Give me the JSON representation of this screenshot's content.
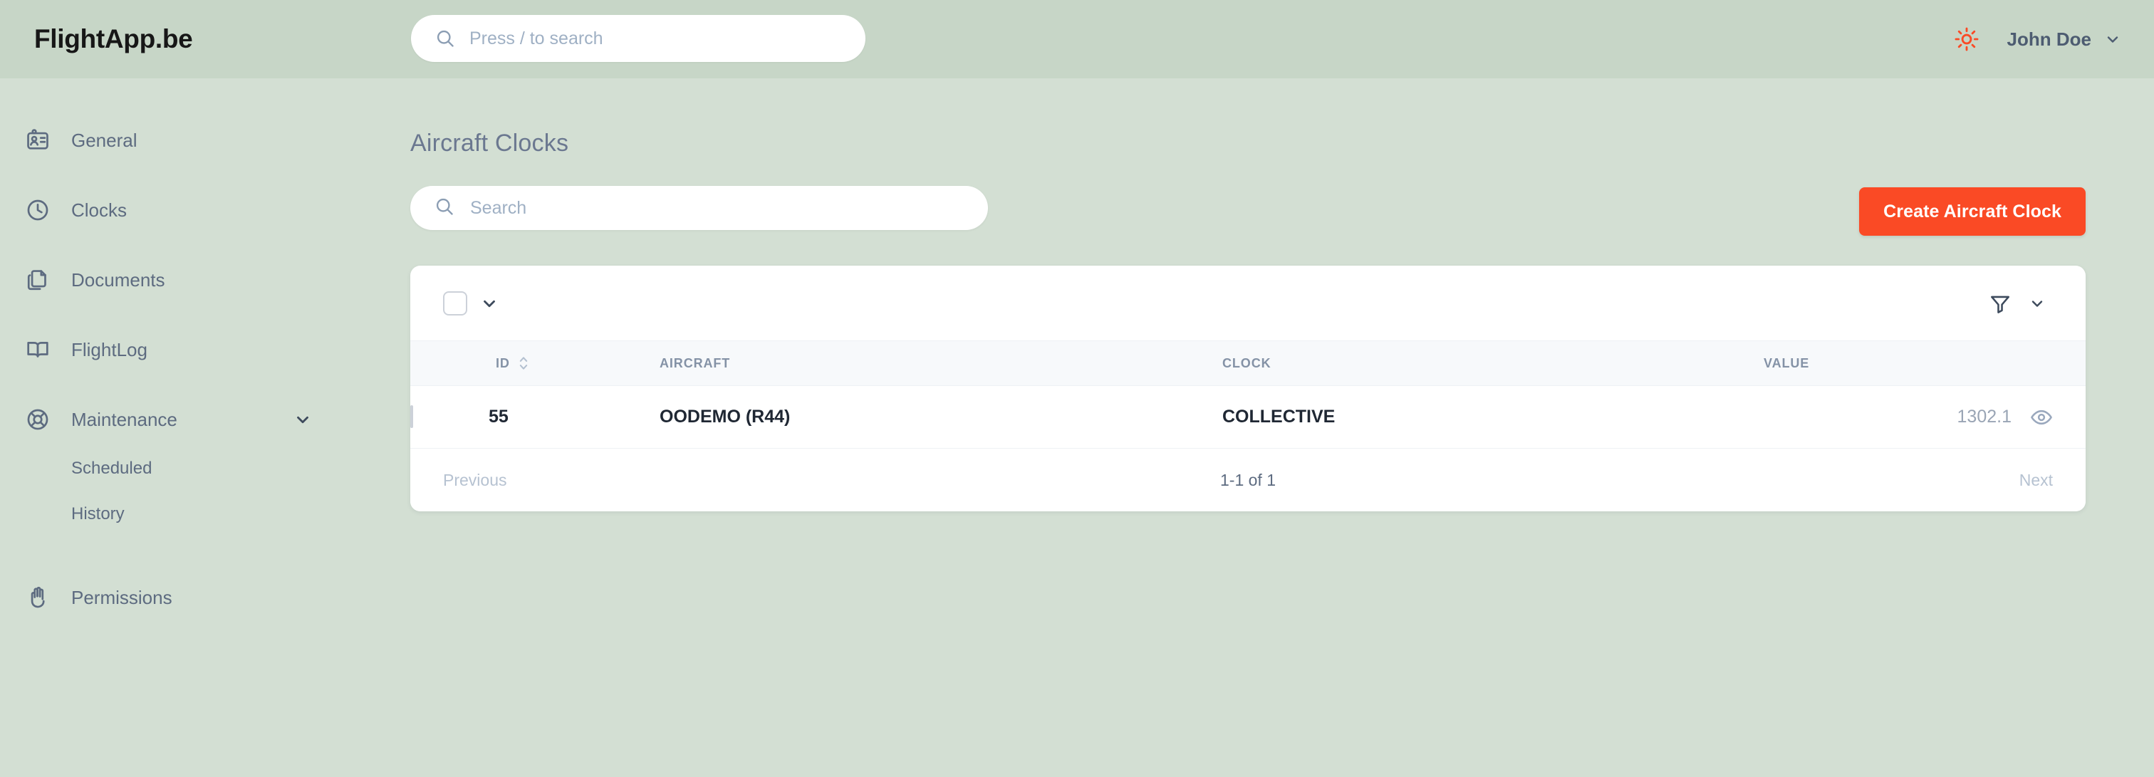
{
  "colors": {
    "header_bg": "#c7d6c7",
    "body_bg": "#d3dfd3",
    "accent": "#fa4a25",
    "text_muted": "#5d6b80",
    "table_header_bg": "#f7f9fb"
  },
  "topbar": {
    "brand": "FlightApp.be",
    "search": {
      "placeholder": "Press / to search",
      "icon": "search-icon"
    },
    "theme_toggle_icon": "sun-icon",
    "user": {
      "name": "John Doe",
      "chevron_icon": "chevron-down-icon"
    }
  },
  "sidebar": {
    "items": [
      {
        "label": "General",
        "icon": "id-card-icon"
      },
      {
        "label": "Clocks",
        "icon": "clock-icon"
      },
      {
        "label": "Documents",
        "icon": "documents-icon"
      },
      {
        "label": "FlightLog",
        "icon": "book-open-icon"
      },
      {
        "label": "Maintenance",
        "icon": "lifebuoy-icon",
        "expandable": true,
        "chevron_icon": "chevron-down-icon"
      },
      {
        "label": "Permissions",
        "icon": "hand-icon"
      }
    ],
    "maintenance_children": [
      {
        "label": "Scheduled"
      },
      {
        "label": "History"
      }
    ]
  },
  "main": {
    "page_title": "Aircraft Clocks",
    "search": {
      "placeholder": "Search",
      "icon": "search-icon"
    },
    "create_button": "Create Aircraft Clock",
    "toolbar": {
      "select_all_checkbox": "",
      "bulk_chevron_icon": "chevron-down-icon",
      "filter_icon": "filter-icon",
      "filter_chevron_icon": "chevron-down-icon"
    },
    "table": {
      "columns": [
        {
          "key": "select",
          "label": ""
        },
        {
          "key": "id",
          "label": "ID",
          "sortable": true,
          "sort_icon": "sort-arrows-icon"
        },
        {
          "key": "aircraft",
          "label": "AIRCRAFT"
        },
        {
          "key": "clock",
          "label": "CLOCK"
        },
        {
          "key": "value",
          "label": "VALUE",
          "align": "right"
        }
      ],
      "rows": [
        {
          "id": "55",
          "aircraft": "OODEMO (R44)",
          "clock": "COLLECTIVE",
          "value": "1302.1",
          "view_icon": "eye-icon"
        }
      ]
    },
    "pagination": {
      "previous": "Previous",
      "info": "1-1 of 1",
      "next": "Next"
    }
  }
}
